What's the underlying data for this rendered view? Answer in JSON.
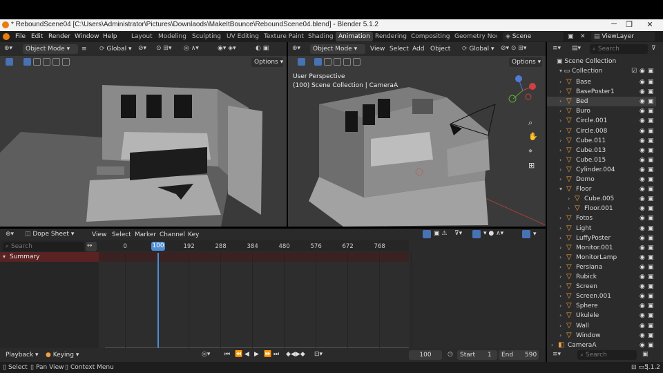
{
  "window": {
    "title": "* ReboundScene04 [C:\\Users\\Administrator\\Pictures\\Downlaods\\MakeItBounce\\ReboundScene04.blend] - Blender 5.1.2",
    "minimize": "─",
    "restore": "❐",
    "close": "✕"
  },
  "menubar": {
    "menus": [
      "File",
      "Edit",
      "Render",
      "Window",
      "Help"
    ],
    "workspaces": [
      "Layout",
      "Modeling",
      "Sculpting",
      "UV Editing",
      "Texture Paint",
      "Shading",
      "Animation",
      "Rendering",
      "Compositing",
      "Geometry Node"
    ],
    "active_workspace": "Animation",
    "scene": "Scene",
    "view_layer": "ViewLayer"
  },
  "viewport_left": {
    "mode": "Object Mode",
    "orientation": "Global",
    "options": "Options"
  },
  "viewport_right": {
    "mode": "Object Mode",
    "menus": [
      "View",
      "Select",
      "Add",
      "Object"
    ],
    "orientation": "Global",
    "options": "Options",
    "perspective": "User Perspective",
    "collection_info": "(100) Scene Collection | CameraA"
  },
  "outliner": {
    "search_placeholder": "Search",
    "scene_collection": "Scene Collection",
    "collection": "Collection",
    "items": [
      {
        "name": "Base",
        "indent": 1
      },
      {
        "name": "BasePoster1",
        "indent": 1
      },
      {
        "name": "Bed",
        "indent": 1,
        "selected": true
      },
      {
        "name": "Buro",
        "indent": 1
      },
      {
        "name": "Circle.001",
        "indent": 1
      },
      {
        "name": "Circle.008",
        "indent": 1
      },
      {
        "name": "Cube.011",
        "indent": 1
      },
      {
        "name": "Cube.013",
        "indent": 1
      },
      {
        "name": "Cube.015",
        "indent": 1
      },
      {
        "name": "Cylinder.004",
        "indent": 1
      },
      {
        "name": "Domo",
        "indent": 1
      },
      {
        "name": "Floor",
        "indent": 1,
        "expanded": true
      },
      {
        "name": "Cube.005",
        "indent": 2
      },
      {
        "name": "Floor.001",
        "indent": 2
      },
      {
        "name": "Fotos",
        "indent": 1
      },
      {
        "name": "Light",
        "indent": 1
      },
      {
        "name": "LuffyPoster",
        "indent": 1
      },
      {
        "name": "Monitor.001",
        "indent": 1
      },
      {
        "name": "MonitorLamp",
        "indent": 1
      },
      {
        "name": "Persiana",
        "indent": 1
      },
      {
        "name": "Rubick",
        "indent": 1
      },
      {
        "name": "Screen",
        "indent": 1
      },
      {
        "name": "Screen.001",
        "indent": 1
      },
      {
        "name": "Sphere",
        "indent": 1
      },
      {
        "name": "Ukulele",
        "indent": 1
      },
      {
        "name": "Wall",
        "indent": 1
      },
      {
        "name": "Window",
        "indent": 1
      },
      {
        "name": "CameraA",
        "indent": 0
      }
    ],
    "bottom_search_placeholder": "Search"
  },
  "dopesheet": {
    "mode": "Dope Sheet",
    "menus": [
      "View",
      "Select",
      "Marker",
      "Channel",
      "Key"
    ],
    "search_placeholder": "Search",
    "summary": "Summary",
    "ticks": [
      "0",
      "192",
      "288",
      "384",
      "480",
      "576",
      "672",
      "768"
    ],
    "current_frame_label": "100"
  },
  "timeline": {
    "playback": "Playback",
    "keying": "Keying",
    "current_frame": "100",
    "start_label": "Start",
    "start": "1",
    "end_label": "End",
    "end": "590"
  },
  "statusbar": {
    "select": "Select",
    "pan_view": "Pan View",
    "context_menu": "Context Menu",
    "version": "5.1.2"
  },
  "colors": {
    "accent": "#4772b3",
    "selection_orange": "#f0a040",
    "playhead": "#4f8ed4",
    "summary_bg": "#5a2222"
  }
}
